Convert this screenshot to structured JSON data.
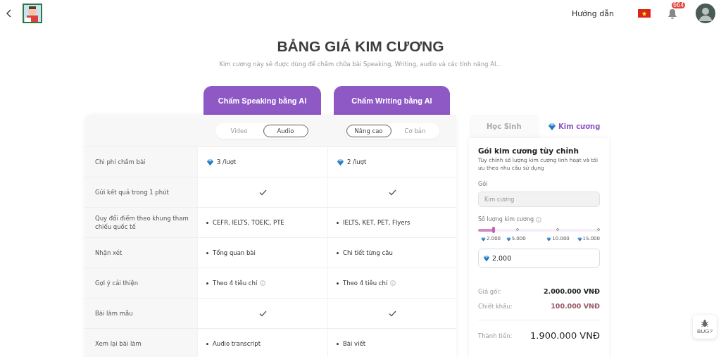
{
  "header": {
    "guide_link": "Hướng dẫn",
    "notification_badge": "664"
  },
  "title": "BẢNG GIÁ KIM CƯƠNG",
  "subtitle": "Kim cương này sẽ được dùng để chấm chữa bài Speaking, Writing, audio và các tính năng AI...",
  "plans": [
    {
      "title": "Chấm Speaking bằng AI",
      "toggle": [
        {
          "label": "Video",
          "selected": false
        },
        {
          "label": "Audio",
          "selected": true
        }
      ]
    },
    {
      "title": "Chấm Writing bằng AI",
      "toggle": [
        {
          "label": "Nâng cao",
          "selected": true
        },
        {
          "label": "Cơ bản",
          "selected": false
        }
      ]
    }
  ],
  "rows": [
    {
      "label": "Chi phí chấm bài",
      "cells": [
        {
          "kind": "diamond",
          "text": "3 /lượt"
        },
        {
          "kind": "diamond",
          "text": "2 /lượt"
        }
      ]
    },
    {
      "label": "Gửi kết quả trong 1 phút",
      "cells": [
        {
          "kind": "check"
        },
        {
          "kind": "check"
        }
      ]
    },
    {
      "label": "Quy đổi điểm theo khung tham chiếu quốc tế",
      "cells": [
        {
          "kind": "bullet",
          "text": "CEFR, IELTS, TOEIC, PTE",
          "info": false
        },
        {
          "kind": "bullet",
          "text": "IELTS, KET, PET, Flyers",
          "info": false
        }
      ]
    },
    {
      "label": "Nhận xét",
      "cells": [
        {
          "kind": "bullet",
          "text": "Tổng quan bài",
          "info": false
        },
        {
          "kind": "bullet",
          "text": "Chi tiết từng câu",
          "info": false
        }
      ]
    },
    {
      "label": "Gợi ý cải thiện",
      "cells": [
        {
          "kind": "bullet",
          "text": "Theo 4 tiêu chí",
          "info": true
        },
        {
          "kind": "bullet",
          "text": "Theo 4 tiêu chí",
          "info": true
        }
      ]
    },
    {
      "label": "Bài làm mẫu",
      "cells": [
        {
          "kind": "check"
        },
        {
          "kind": "check"
        }
      ]
    },
    {
      "label": "Xem lại bài làm",
      "cells": [
        {
          "kind": "bullet",
          "text": "Audio transcript",
          "info": false
        },
        {
          "kind": "bullet",
          "text": "Bài viết",
          "info": false
        }
      ]
    }
  ],
  "panel": {
    "tabs": [
      {
        "label": "Học Sinh",
        "selected": false,
        "kind": "plain"
      },
      {
        "label": "Kim cương",
        "selected": true,
        "kind": "diamond"
      }
    ],
    "package_title": "Gói kim cương tùy chỉnh",
    "description": "Tùy chỉnh số lượng kim cương linh hoạt và tối ưu theo nhu cầu sử dụng",
    "package_label": "Gói",
    "package_field": {
      "placeholder": "Kim cương"
    },
    "quantity_label": "Số lượng kim cương",
    "slider": {
      "level": 0.13,
      "ticks": [
        "2.000",
        "5.000",
        "10.000",
        "15.000"
      ]
    },
    "quantity_value": "2.000",
    "summary": [
      {
        "label": "Giá gói:",
        "value": "2.000.000 VNĐ",
        "kind": "normal"
      },
      {
        "label": "Chiết khấu:",
        "value": "100.000 VNĐ",
        "kind": "discount"
      }
    ],
    "total": {
      "label": "Thành tiền:",
      "value": "1.900.000 VNĐ"
    }
  },
  "bug_button": "BUG?"
}
